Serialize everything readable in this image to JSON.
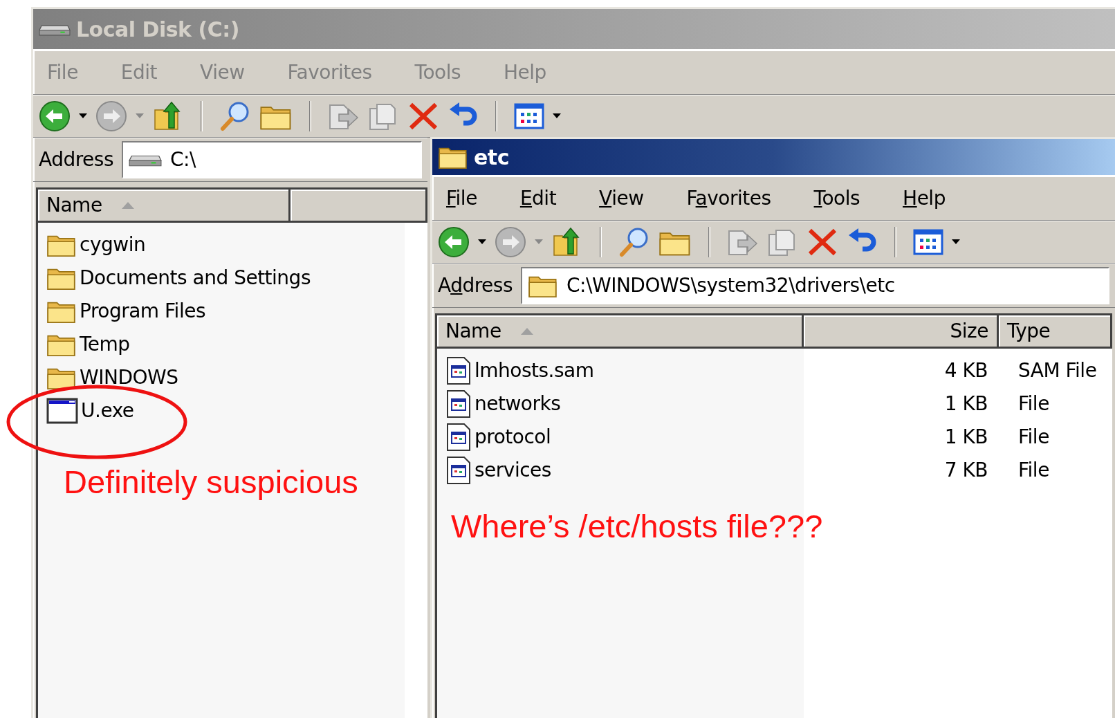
{
  "windows": [
    {
      "title": "Local Disk (C:)",
      "active": false,
      "menu": [
        {
          "label": "File"
        },
        {
          "label": "Edit"
        },
        {
          "label": "View"
        },
        {
          "label": "Favorites"
        },
        {
          "label": "Tools"
        },
        {
          "label": "Help"
        }
      ],
      "address_label": {
        "label": "Address"
      },
      "address": "C:\\",
      "columns": [
        {
          "label": "Name",
          "sorted": true
        },
        {
          "sorted": false
        }
      ],
      "rows": [
        {
          "kind": "folder",
          "name": "cygwin"
        },
        {
          "kind": "folder",
          "name": "Documents and Settings"
        },
        {
          "kind": "folder",
          "name": "Program Files"
        },
        {
          "kind": "folder",
          "name": "Temp"
        },
        {
          "kind": "folder",
          "name": "WINDOWS"
        },
        {
          "kind": "exe",
          "name": "U.exe"
        }
      ],
      "annotation": "Definitely suspicious"
    },
    {
      "title": "etc",
      "active": true,
      "menu": [
        {
          "key": "F",
          "rest": "ile"
        },
        {
          "key": "E",
          "rest": "dit"
        },
        {
          "key": "V",
          "rest": "iew"
        },
        {
          "lead": "F",
          "key": "a",
          "rest": "vorites"
        },
        {
          "key": "T",
          "rest": "ools"
        },
        {
          "key": "H",
          "rest": "elp"
        }
      ],
      "address_label": {
        "lead": "A",
        "key": "d",
        "rest": "dress"
      },
      "address": "C:\\WINDOWS\\system32\\drivers\\etc",
      "columns": [
        {
          "label": "Name",
          "sorted": true
        },
        {
          "label": "Size",
          "sorted": false
        },
        {
          "label": "Type",
          "sorted": false
        }
      ],
      "rows": [
        {
          "kind": "file",
          "name": "lmhosts.sam",
          "size": "4 KB",
          "type": "SAM File"
        },
        {
          "kind": "file",
          "name": "networks",
          "size": "1 KB",
          "type": "File"
        },
        {
          "kind": "file",
          "name": "protocol",
          "size": "1 KB",
          "type": "File"
        },
        {
          "kind": "file",
          "name": "services",
          "size": "7 KB",
          "type": "File"
        }
      ],
      "annotation": "Where’s /etc/hosts file???"
    }
  ]
}
